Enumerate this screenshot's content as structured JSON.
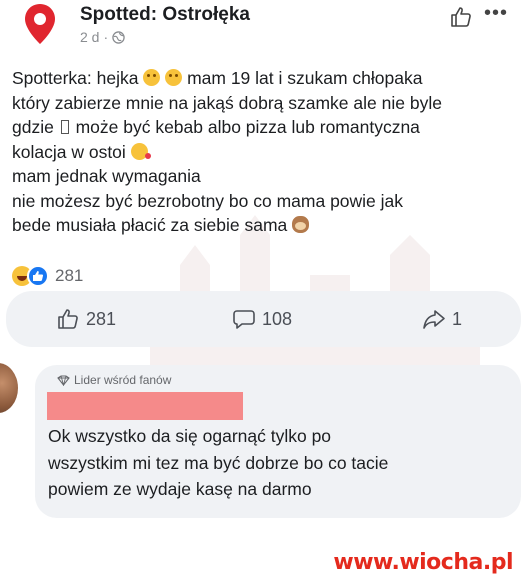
{
  "post": {
    "page_name": "Spotted: Ostrołęka",
    "time": "2 d",
    "separator": "·",
    "lines": [
      {
        "before": "Spotterka: hejka ",
        "after": " mam 19 lat i szukam chłopaka"
      },
      {
        "text": "który zabierze mnie na jakąś dobrą szamke ale nie byle"
      },
      {
        "before": "gdzie ",
        "after": " może być kebab albo pizza lub romantyczna"
      },
      {
        "before": "kolacja w ostoi ",
        "after": ""
      },
      {
        "text": "mam jednak wymagania"
      },
      {
        "text": "nie możesz być bezrobotny bo co mama powie jak"
      },
      {
        "before": "bede musiała płacić za siebie sama ",
        "after": ""
      }
    ],
    "reaction_count": "281"
  },
  "actions": {
    "like_count": "281",
    "comment_count": "108",
    "share_count": "1"
  },
  "comment": {
    "badge_label": "Lider wśród fanów",
    "lines": [
      "Ok wszystko da się ogarnąć tylko po",
      "wszystkim mi tez ma być dobrze bo co tacie",
      "powiem ze wydaje kasę na darmo"
    ]
  },
  "site_watermark": "www.wiocha.pl",
  "icons": {
    "pin": "location-pin-icon",
    "globe": "globe-icon",
    "like": "thumb-up-icon",
    "comment": "speech-bubble-icon",
    "share": "share-arrow-icon",
    "more": "more-dots-icon"
  },
  "colors": {
    "pin_red": "#e0262f",
    "like_blue": "#1877f2",
    "bubble_bg": "#f0f2f5",
    "redaction": "#f58a8a",
    "site_red": "#e42a1d"
  }
}
